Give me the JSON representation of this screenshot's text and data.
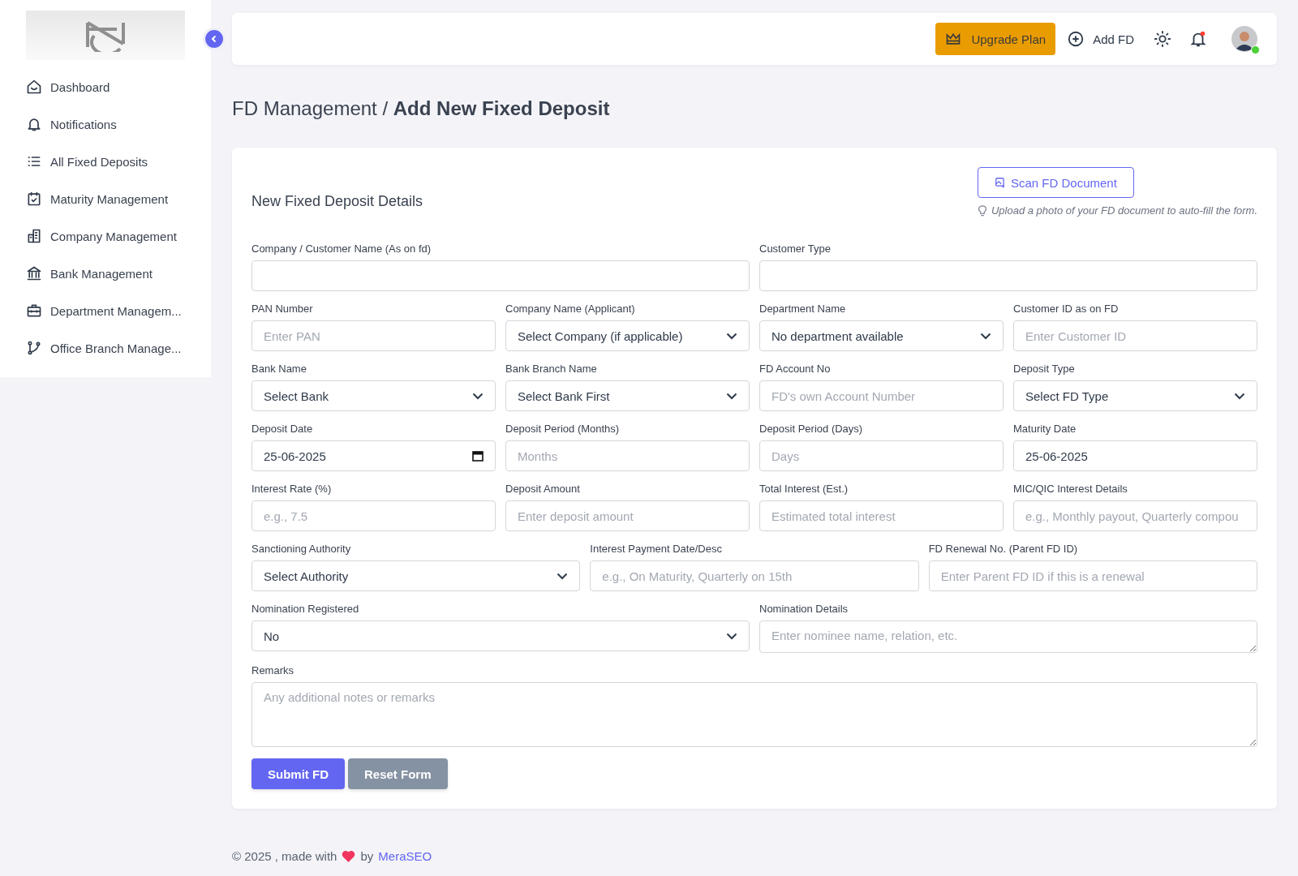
{
  "sidebar": {
    "items": [
      {
        "label": "Dashboard",
        "selected": false
      },
      {
        "label": "Notifications",
        "selected": false
      },
      {
        "label": "All Fixed Deposits",
        "selected": false
      },
      {
        "label": "Maturity Management",
        "selected": false
      },
      {
        "label": "Company Management",
        "selected": false
      },
      {
        "label": "Bank Management",
        "selected": false
      },
      {
        "label": "Department Managem...",
        "selected": false
      },
      {
        "label": "Office Branch Manage...",
        "selected": false
      }
    ]
  },
  "topbar": {
    "upgrade": "Upgrade Plan",
    "add": "Add FD",
    "notification_dot": true,
    "online": true
  },
  "breadcrumb": {
    "parent": "FD Management / ",
    "current": "Add New Fixed Deposit"
  },
  "form": {
    "title": "New Fixed Deposit Details",
    "scan_button": "Scan FD Document",
    "scan_hint": "Upload a photo of your FD document to auto-fill the form.",
    "rows": [
      {
        "fields": [
          {
            "label": "Company / Customer Name (As on fd)",
            "kind": "text"
          },
          {
            "label": "Customer Type",
            "kind": "text"
          }
        ]
      },
      {
        "fields": [
          {
            "label": "PAN Number",
            "kind": "text",
            "placeholder": "Enter PAN"
          },
          {
            "label": "Company Name (Applicant)",
            "kind": "select",
            "value": "Select Company (if applicable)"
          },
          {
            "label": "Department Name",
            "kind": "select",
            "value": "No department available"
          },
          {
            "label": "Customer ID as on FD",
            "kind": "text",
            "placeholder": "Enter Customer ID"
          }
        ]
      },
      {
        "fields": [
          {
            "label": "Bank Name",
            "kind": "select",
            "value": "Select Bank"
          },
          {
            "label": "Bank Branch Name",
            "kind": "select",
            "value": "Select Bank First"
          },
          {
            "label": "FD Account No",
            "kind": "text",
            "placeholder": "FD's own Account Number"
          },
          {
            "label": "Deposit Type",
            "kind": "select",
            "value": "Select FD Type"
          }
        ]
      },
      {
        "fields": [
          {
            "label": "Deposit Date",
            "kind": "date",
            "value": "25-06-2025"
          },
          {
            "label": "Deposit Period (Months)",
            "kind": "text",
            "placeholder": "Months"
          },
          {
            "label": "Deposit Period (Days)",
            "kind": "text",
            "placeholder": "Days"
          },
          {
            "label": "Maturity Date",
            "kind": "text",
            "value": "25-06-2025"
          }
        ]
      },
      {
        "fields": [
          {
            "label": "Interest Rate (%)",
            "kind": "text",
            "placeholder": "e.g., 7.5"
          },
          {
            "label": "Deposit Amount",
            "kind": "text",
            "placeholder": "Enter deposit amount"
          },
          {
            "label": "Total Interest (Est.)",
            "kind": "text",
            "placeholder": "Estimated total interest"
          },
          {
            "label": "MIC/QIC Interest Details",
            "kind": "text",
            "placeholder": "e.g., Monthly payout, Quarterly compou"
          }
        ]
      },
      {
        "fields": [
          {
            "label": "Sanctioning Authority",
            "kind": "select",
            "value": "Select Authority"
          },
          {
            "label": "Interest Payment Date/Desc",
            "kind": "text",
            "placeholder": "e.g., On Maturity, Quarterly on 15th"
          },
          {
            "label": "FD Renewal No. (Parent FD ID)",
            "kind": "text",
            "placeholder": "Enter Parent FD ID if this is a renewal"
          }
        ]
      },
      {
        "fields": [
          {
            "label": "Nomination Registered",
            "kind": "select",
            "value": "No"
          },
          {
            "label": "Nomination Details",
            "kind": "textarea",
            "placeholder": "Enter nominee name, relation, etc."
          }
        ]
      },
      {
        "fields": [
          {
            "label": "Remarks",
            "kind": "bigtextarea",
            "placeholder": "Any additional notes or remarks"
          }
        ]
      }
    ],
    "submit": "Submit FD",
    "reset": "Reset Form"
  },
  "footer": {
    "text": "© 2025 , made with",
    "by": "by",
    "link": "MeraSEO"
  }
}
